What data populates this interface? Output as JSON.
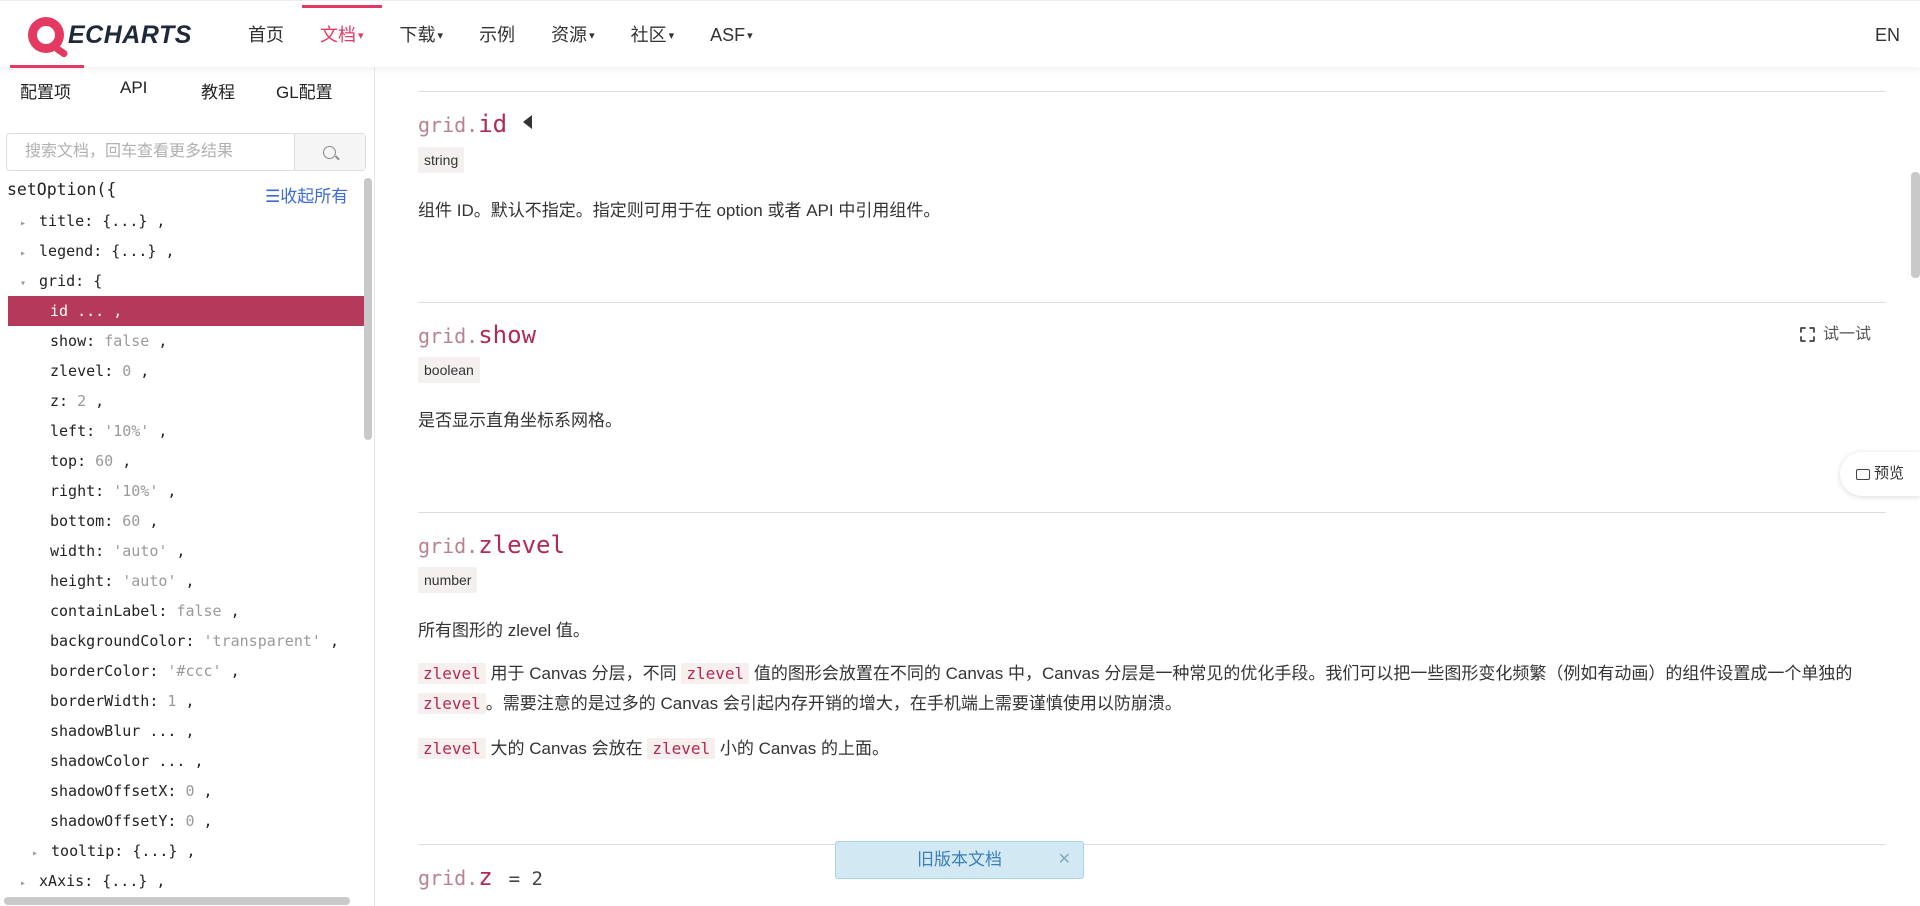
{
  "logo": {
    "text": "ECHARTS"
  },
  "nav": {
    "items": [
      {
        "label": "首页",
        "caret": ""
      },
      {
        "label": "文档",
        "caret": "▾"
      },
      {
        "label": "下载",
        "caret": "▾"
      },
      {
        "label": "示例",
        "caret": ""
      },
      {
        "label": "资源",
        "caret": "▾"
      },
      {
        "label": "社区",
        "caret": "▾"
      },
      {
        "label": "ASF",
        "caret": "▾"
      }
    ],
    "active": "文档",
    "lang": "EN"
  },
  "sidebar": {
    "tabs": [
      "配置项",
      "API",
      "教程",
      "GL配置"
    ],
    "search_placeholder": "搜索文档，回车查看更多结果",
    "tree_head": "setOption({",
    "collapse_all": "☰收起所有",
    "rows": [
      {
        "arrow": "▸",
        "key": "title",
        "sep": ": ",
        "value": "{...}",
        "tail": " ,",
        "muted": false
      },
      {
        "arrow": "▸",
        "key": "legend",
        "sep": ": ",
        "value": "{...}",
        "tail": " ,",
        "muted": false
      },
      {
        "arrow": "▾",
        "key": "grid",
        "sep": ": ",
        "value": "{",
        "tail": "",
        "muted": false
      },
      {
        "arrow": "",
        "key": "id",
        "sep": " ",
        "value": "...",
        "tail": " ,",
        "muted": false,
        "active": true
      },
      {
        "arrow": "",
        "key": "show",
        "sep": ": ",
        "value": "false",
        "tail": " ,",
        "muted": true
      },
      {
        "arrow": "",
        "key": "zlevel",
        "sep": ": ",
        "value": "0",
        "tail": " ,",
        "muted": true
      },
      {
        "arrow": "",
        "key": "z",
        "sep": ": ",
        "value": "2",
        "tail": " ,",
        "muted": true
      },
      {
        "arrow": "",
        "key": "left",
        "sep": ": ",
        "value": "'10%'",
        "tail": " ,",
        "muted": true
      },
      {
        "arrow": "",
        "key": "top",
        "sep": ": ",
        "value": "60",
        "tail": " ,",
        "muted": true
      },
      {
        "arrow": "",
        "key": "right",
        "sep": ": ",
        "value": "'10%'",
        "tail": " ,",
        "muted": true
      },
      {
        "arrow": "",
        "key": "bottom",
        "sep": ": ",
        "value": "60",
        "tail": " ,",
        "muted": true
      },
      {
        "arrow": "",
        "key": "width",
        "sep": ": ",
        "value": "'auto'",
        "tail": " ,",
        "muted": true
      },
      {
        "arrow": "",
        "key": "height",
        "sep": ": ",
        "value": "'auto'",
        "tail": " ,",
        "muted": true
      },
      {
        "arrow": "",
        "key": "containLabel",
        "sep": ": ",
        "value": "false",
        "tail": " ,",
        "muted": true
      },
      {
        "arrow": "",
        "key": "backgroundColor",
        "sep": ": ",
        "value": "'transparent'",
        "tail": " ,",
        "muted": true
      },
      {
        "arrow": "",
        "key": "borderColor",
        "sep": ": ",
        "value": "'#ccc'",
        "tail": " ,",
        "muted": true
      },
      {
        "arrow": "",
        "key": "borderWidth",
        "sep": ": ",
        "value": "1",
        "tail": " ,",
        "muted": true
      },
      {
        "arrow": "",
        "key": "shadowBlur",
        "sep": " ",
        "value": "...",
        "tail": " ,",
        "muted": false
      },
      {
        "arrow": "",
        "key": "shadowColor",
        "sep": " ",
        "value": "...",
        "tail": " ,",
        "muted": false
      },
      {
        "arrow": "",
        "key": "shadowOffsetX",
        "sep": ": ",
        "value": "0",
        "tail": " ,",
        "muted": true
      },
      {
        "arrow": "",
        "key": "shadowOffsetY",
        "sep": ": ",
        "value": "0",
        "tail": " ,",
        "muted": true
      },
      {
        "arrow": "▸",
        "key": "tooltip",
        "sep": ": ",
        "value": "{...}",
        "tail": " ,",
        "muted": false,
        "nested": true
      },
      {
        "arrow": "▸",
        "key": "xAxis",
        "sep": ": ",
        "value": "{...}",
        "tail": " ,",
        "muted": false
      }
    ]
  },
  "main": {
    "props": [
      {
        "prefix": "grid.",
        "name": "id",
        "type": "string",
        "desc": "组件 ID。默认不指定。指定则可用于在 option 或者 API 中引用组件。"
      },
      {
        "prefix": "grid.",
        "name": "show",
        "type": "boolean",
        "desc": "是否显示直角坐标系网格。",
        "try": "试一试"
      },
      {
        "prefix": "grid.",
        "name": "zlevel",
        "type": "number",
        "desc1": "所有图形的 zlevel 值。",
        "desc2": {
          "c1": "zlevel",
          "t1": "用于 Canvas 分层，不同",
          "c2": "zlevel",
          "t2": "值的图形会放置在不同的 Canvas 中，Canvas 分层是一种常见的优化手段。我们可以把一些图形变化频繁（例如有动画）的组件设置成一个单独的",
          "c3": "zlevel",
          "t3": "。需要注意的是过多的 Canvas 会引起内存开销的增大，在手机端上需要谨慎使用以防崩溃。"
        },
        "desc3": {
          "c1": "zlevel",
          "t1": "大的 Canvas 会放在",
          "c2": "zlevel",
          "t2": "小的 Canvas 的上面。"
        }
      },
      {
        "prefix": "grid.",
        "name": "z",
        "default": "= 2"
      }
    ],
    "preview": "预览",
    "old_doc": "旧版本文档",
    "old_doc_close": "✕"
  },
  "colors": {
    "accent": "#e43961",
    "active_row": "#b5395b",
    "prop_name": "#b22a52",
    "link": "#3c6bd6"
  }
}
